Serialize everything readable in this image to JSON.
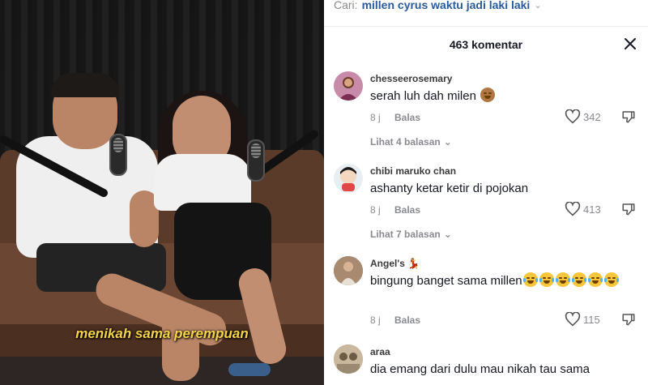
{
  "video": {
    "subtitle": "menikah sama perempuan"
  },
  "search": {
    "label": "Cari:",
    "query": "millen cyrus waktu jadi laki laki",
    "chevron_icon": "chevron-down-icon"
  },
  "comments_header": {
    "title": "463 komentar",
    "close_icon": "close-icon"
  },
  "comments": [
    {
      "username": "chesseerosemary",
      "text": "serah luh dah milen",
      "emoji": "see-no-evil-monkey",
      "age": "8 j",
      "reply_label": "Balas",
      "likes": "342",
      "replies_label": "Lihat 4 balasan",
      "avatar_color": "#c78aa8"
    },
    {
      "username": "chibi maruko chan",
      "text": "ashanty ketar ketir di pojokan",
      "age": "8 j",
      "reply_label": "Balas",
      "likes": "413",
      "replies_label": "Lihat 7 balasan",
      "avatar_color": "#e9eef3"
    },
    {
      "username": "Angel's",
      "username_emoji": "dancer",
      "text": "bingung banget sama millen",
      "emoji": "tears-of-joy",
      "emoji_count": 6,
      "age": "8 j",
      "reply_label": "Balas",
      "likes": "115",
      "avatar_color": "#8b6a55"
    },
    {
      "username": "araa",
      "text": "dia emang dari dulu mau nikah tau sama",
      "avatar_color": "#b5a38a"
    }
  ],
  "colors": {
    "accent_link": "#2b5b9a",
    "subtitle": "#f5d34a",
    "muted": "#8a8b91"
  }
}
